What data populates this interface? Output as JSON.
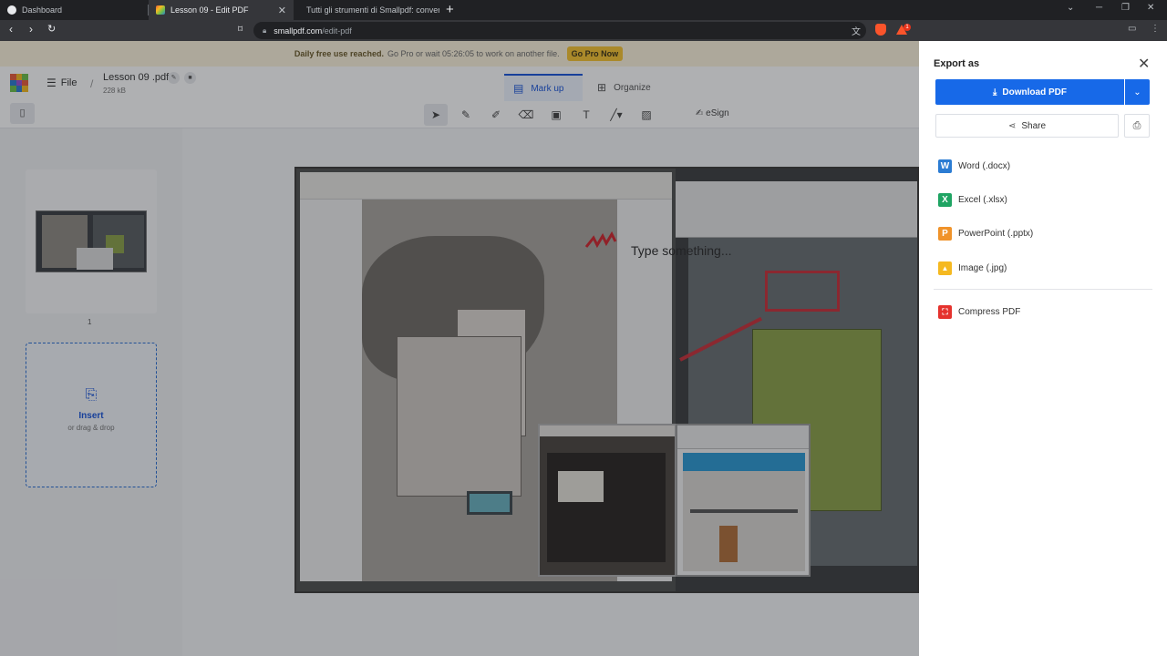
{
  "browser": {
    "tabs": [
      {
        "title": "Dashboard",
        "favicon_color": "#e8eaed"
      },
      {
        "title": "Lesson 09 - Edit PDF",
        "favicon_color": "#6cbf4b"
      },
      {
        "title": "Tutti gli strumenti di Smallpdf: conver",
        "favicon_color": "#e85c3a"
      }
    ],
    "url_domain": "smallpdf.com",
    "url_path": "/edit-pdf",
    "new_tab": "+",
    "badge_count": "1"
  },
  "banner": {
    "bold": "Daily free use reached.",
    "text": "Go Pro or wait 05:26:05 to work on another file.",
    "cta": "Go Pro Now"
  },
  "header": {
    "file_menu": "File",
    "separator": "/",
    "file_name": "Lesson 09 .pdf",
    "file_size": "228 kB",
    "tabs": [
      {
        "label": "Mark up",
        "icon": "markup-icon"
      },
      {
        "label": "Organize",
        "icon": "grid-icon"
      }
    ],
    "tools": [
      "cursor-icon",
      "pen-icon",
      "highlighter-icon",
      "eraser-icon",
      "text-box-icon",
      "text-icon",
      "line-icon",
      "image-icon"
    ],
    "esign_label": "eSign"
  },
  "sidebar": {
    "page_number": "1",
    "insert_title": "Insert",
    "insert_subtitle": "or drag & drop"
  },
  "document": {
    "annotation_text": "Type something..."
  },
  "export_panel": {
    "title": "Export as",
    "download_label": "Download PDF",
    "share_label": "Share",
    "options": [
      {
        "label": "Word (.docx)",
        "icon": "word-icon",
        "letter": "W",
        "color": "#2b7cd3"
      },
      {
        "label": "Excel (.xlsx)",
        "icon": "excel-icon",
        "letter": "X",
        "color": "#1fa463"
      },
      {
        "label": "PowerPoint (.pptx)",
        "icon": "powerpoint-icon",
        "letter": "P",
        "color": "#f0932a"
      },
      {
        "label": "Image (.jpg)",
        "icon": "image-icon",
        "letter": "▲",
        "color": "#f5b921"
      }
    ],
    "compress_label": "Compress PDF",
    "compress_color": "#e5322d"
  }
}
